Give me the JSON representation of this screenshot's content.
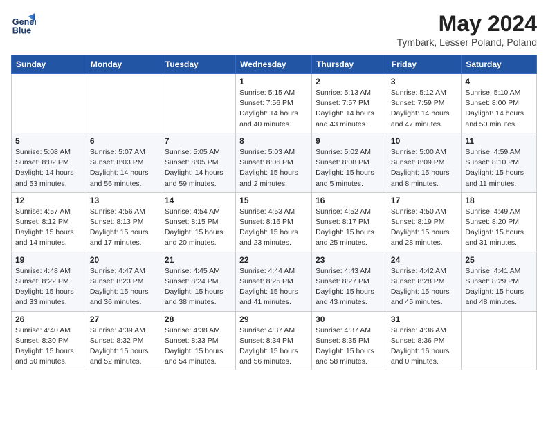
{
  "header": {
    "logo_line1": "General",
    "logo_line2": "Blue",
    "month_year": "May 2024",
    "location": "Tymbark, Lesser Poland, Poland"
  },
  "days_of_week": [
    "Sunday",
    "Monday",
    "Tuesday",
    "Wednesday",
    "Thursday",
    "Friday",
    "Saturday"
  ],
  "weeks": [
    [
      {
        "day": "",
        "info": ""
      },
      {
        "day": "",
        "info": ""
      },
      {
        "day": "",
        "info": ""
      },
      {
        "day": "1",
        "info": "Sunrise: 5:15 AM\nSunset: 7:56 PM\nDaylight: 14 hours\nand 40 minutes."
      },
      {
        "day": "2",
        "info": "Sunrise: 5:13 AM\nSunset: 7:57 PM\nDaylight: 14 hours\nand 43 minutes."
      },
      {
        "day": "3",
        "info": "Sunrise: 5:12 AM\nSunset: 7:59 PM\nDaylight: 14 hours\nand 47 minutes."
      },
      {
        "day": "4",
        "info": "Sunrise: 5:10 AM\nSunset: 8:00 PM\nDaylight: 14 hours\nand 50 minutes."
      }
    ],
    [
      {
        "day": "5",
        "info": "Sunrise: 5:08 AM\nSunset: 8:02 PM\nDaylight: 14 hours\nand 53 minutes."
      },
      {
        "day": "6",
        "info": "Sunrise: 5:07 AM\nSunset: 8:03 PM\nDaylight: 14 hours\nand 56 minutes."
      },
      {
        "day": "7",
        "info": "Sunrise: 5:05 AM\nSunset: 8:05 PM\nDaylight: 14 hours\nand 59 minutes."
      },
      {
        "day": "8",
        "info": "Sunrise: 5:03 AM\nSunset: 8:06 PM\nDaylight: 15 hours\nand 2 minutes."
      },
      {
        "day": "9",
        "info": "Sunrise: 5:02 AM\nSunset: 8:08 PM\nDaylight: 15 hours\nand 5 minutes."
      },
      {
        "day": "10",
        "info": "Sunrise: 5:00 AM\nSunset: 8:09 PM\nDaylight: 15 hours\nand 8 minutes."
      },
      {
        "day": "11",
        "info": "Sunrise: 4:59 AM\nSunset: 8:10 PM\nDaylight: 15 hours\nand 11 minutes."
      }
    ],
    [
      {
        "day": "12",
        "info": "Sunrise: 4:57 AM\nSunset: 8:12 PM\nDaylight: 15 hours\nand 14 minutes."
      },
      {
        "day": "13",
        "info": "Sunrise: 4:56 AM\nSunset: 8:13 PM\nDaylight: 15 hours\nand 17 minutes."
      },
      {
        "day": "14",
        "info": "Sunrise: 4:54 AM\nSunset: 8:15 PM\nDaylight: 15 hours\nand 20 minutes."
      },
      {
        "day": "15",
        "info": "Sunrise: 4:53 AM\nSunset: 8:16 PM\nDaylight: 15 hours\nand 23 minutes."
      },
      {
        "day": "16",
        "info": "Sunrise: 4:52 AM\nSunset: 8:17 PM\nDaylight: 15 hours\nand 25 minutes."
      },
      {
        "day": "17",
        "info": "Sunrise: 4:50 AM\nSunset: 8:19 PM\nDaylight: 15 hours\nand 28 minutes."
      },
      {
        "day": "18",
        "info": "Sunrise: 4:49 AM\nSunset: 8:20 PM\nDaylight: 15 hours\nand 31 minutes."
      }
    ],
    [
      {
        "day": "19",
        "info": "Sunrise: 4:48 AM\nSunset: 8:22 PM\nDaylight: 15 hours\nand 33 minutes."
      },
      {
        "day": "20",
        "info": "Sunrise: 4:47 AM\nSunset: 8:23 PM\nDaylight: 15 hours\nand 36 minutes."
      },
      {
        "day": "21",
        "info": "Sunrise: 4:45 AM\nSunset: 8:24 PM\nDaylight: 15 hours\nand 38 minutes."
      },
      {
        "day": "22",
        "info": "Sunrise: 4:44 AM\nSunset: 8:25 PM\nDaylight: 15 hours\nand 41 minutes."
      },
      {
        "day": "23",
        "info": "Sunrise: 4:43 AM\nSunset: 8:27 PM\nDaylight: 15 hours\nand 43 minutes."
      },
      {
        "day": "24",
        "info": "Sunrise: 4:42 AM\nSunset: 8:28 PM\nDaylight: 15 hours\nand 45 minutes."
      },
      {
        "day": "25",
        "info": "Sunrise: 4:41 AM\nSunset: 8:29 PM\nDaylight: 15 hours\nand 48 minutes."
      }
    ],
    [
      {
        "day": "26",
        "info": "Sunrise: 4:40 AM\nSunset: 8:30 PM\nDaylight: 15 hours\nand 50 minutes."
      },
      {
        "day": "27",
        "info": "Sunrise: 4:39 AM\nSunset: 8:32 PM\nDaylight: 15 hours\nand 52 minutes."
      },
      {
        "day": "28",
        "info": "Sunrise: 4:38 AM\nSunset: 8:33 PM\nDaylight: 15 hours\nand 54 minutes."
      },
      {
        "day": "29",
        "info": "Sunrise: 4:37 AM\nSunset: 8:34 PM\nDaylight: 15 hours\nand 56 minutes."
      },
      {
        "day": "30",
        "info": "Sunrise: 4:37 AM\nSunset: 8:35 PM\nDaylight: 15 hours\nand 58 minutes."
      },
      {
        "day": "31",
        "info": "Sunrise: 4:36 AM\nSunset: 8:36 PM\nDaylight: 16 hours\nand 0 minutes."
      },
      {
        "day": "",
        "info": ""
      }
    ]
  ]
}
